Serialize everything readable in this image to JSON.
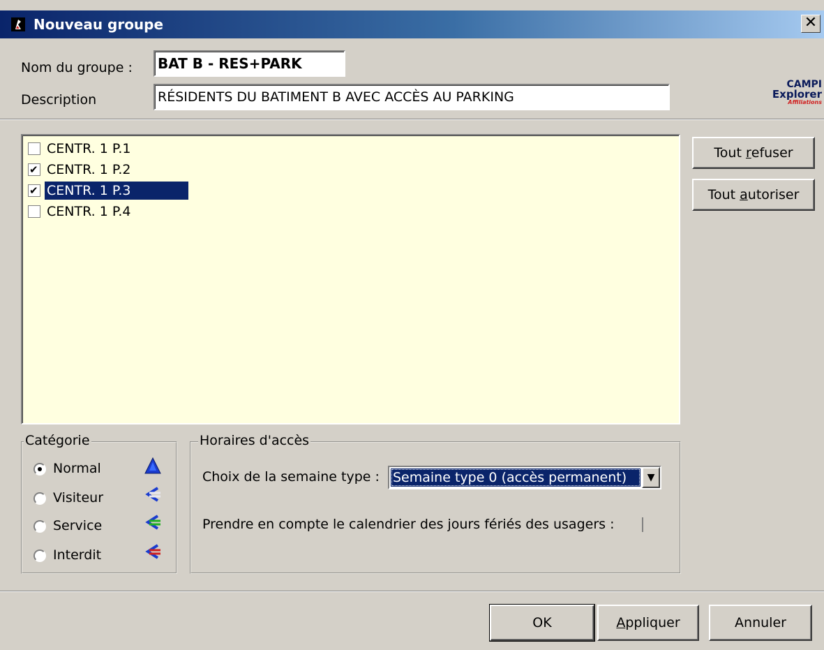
{
  "window": {
    "title": "Nouveau groupe",
    "close_glyph": "✕"
  },
  "form": {
    "name_label": "Nom du groupe :",
    "name_value": "BAT B - RES+PARK",
    "desc_label": "Description",
    "desc_value": "RÉSIDENTS DU BATIMENT B AVEC ACCÈS AU PARKING"
  },
  "logo": {
    "line1": "CAMPI",
    "line2": "Explorer",
    "line3": "Affiliations"
  },
  "list": {
    "items": [
      {
        "label": "CENTR. 1 P.1",
        "checked": false,
        "selected": false
      },
      {
        "label": "CENTR. 1 P.2",
        "checked": true,
        "selected": false
      },
      {
        "label": "CENTR. 1 P.3",
        "checked": true,
        "selected": true
      },
      {
        "label": "CENTR. 1 P.4",
        "checked": false,
        "selected": false
      }
    ]
  },
  "buttons": {
    "refuse_all_pre": "Tout ",
    "refuse_all_key": "r",
    "refuse_all_post": "efuser",
    "allow_all_pre": "Tout ",
    "allow_all_key": "a",
    "allow_all_post": "utoriser",
    "ok": "OK",
    "apply_key": "A",
    "apply_post": "ppliquer",
    "cancel": "Annuler"
  },
  "category": {
    "legend": "Catégorie",
    "options": [
      {
        "label": "Normal",
        "selected": true,
        "icon": "blue-person-icon",
        "color": "#1a3ccf"
      },
      {
        "label": "Visiteur",
        "selected": false,
        "icon": "white-person-icon",
        "color": "#e8e8f0"
      },
      {
        "label": "Service",
        "selected": false,
        "icon": "green-person-icon",
        "color": "#22b022"
      },
      {
        "label": "Interdit",
        "selected": false,
        "icon": "red-person-icon",
        "color": "#d02020"
      }
    ]
  },
  "schedule": {
    "legend": "Horaires d'accès",
    "week_label": "Choix de la semaine type :",
    "week_value": "Semaine type 0 (accès permanent)",
    "holiday_label": "Prendre en compte le calendrier des jours fériés des usagers :",
    "holiday_checked": false
  },
  "colors": {
    "listbox_bg": "#ffffe0",
    "selection": "#0a246a",
    "dialog_bg": "#d4d0c8"
  }
}
